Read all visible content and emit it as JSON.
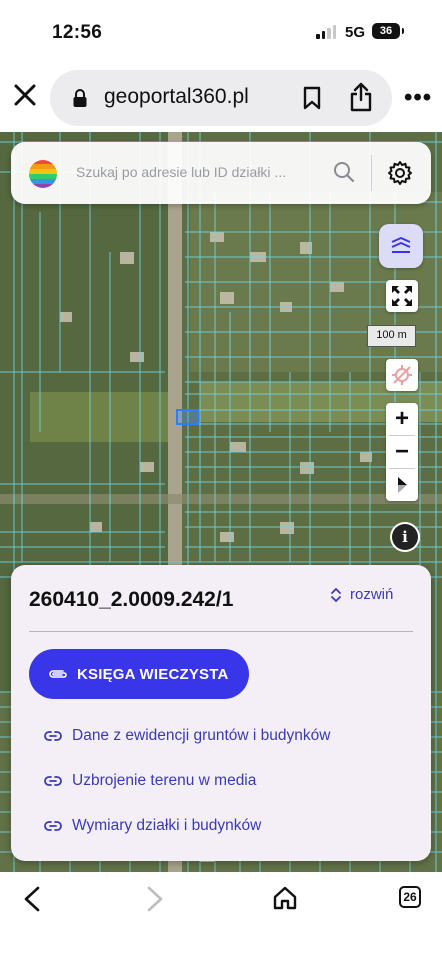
{
  "status_bar": {
    "time": "12:56",
    "network": "5G",
    "battery": "36"
  },
  "browser": {
    "url": "geoportal360.pl",
    "tabs_count": "26"
  },
  "search": {
    "placeholder": "Szukaj po adresie lub ID działki ..."
  },
  "map": {
    "scale_label": "100 m",
    "zoom_in": "+",
    "zoom_out": "−"
  },
  "card": {
    "parcel_id": "260410_2.0009.242/1",
    "expand_label": "rozwiń",
    "primary_button": "KSIĘGA WIECZYSTA",
    "links": [
      "Dane z ewidencji gruntów i budynków",
      "Uzbrojenie terenu w media",
      "Wymiary działki i budynków"
    ]
  },
  "colors": {
    "accent": "#3935e8",
    "link": "#3a3ab4",
    "parcel_lines": "#6fd3e0",
    "card_bg": "#f4eff7"
  },
  "icons": [
    "close-icon",
    "lock-icon",
    "bookmark-icon",
    "share-icon",
    "more-icon",
    "logo-icon",
    "search-icon",
    "gear-icon",
    "layers-icon",
    "fullscreen-icon",
    "locate-off-icon",
    "compass-icon",
    "info-icon",
    "expand-icon",
    "paperclip-icon",
    "link-icon",
    "back-icon",
    "forward-icon",
    "home-icon",
    "tabs-icon"
  ]
}
